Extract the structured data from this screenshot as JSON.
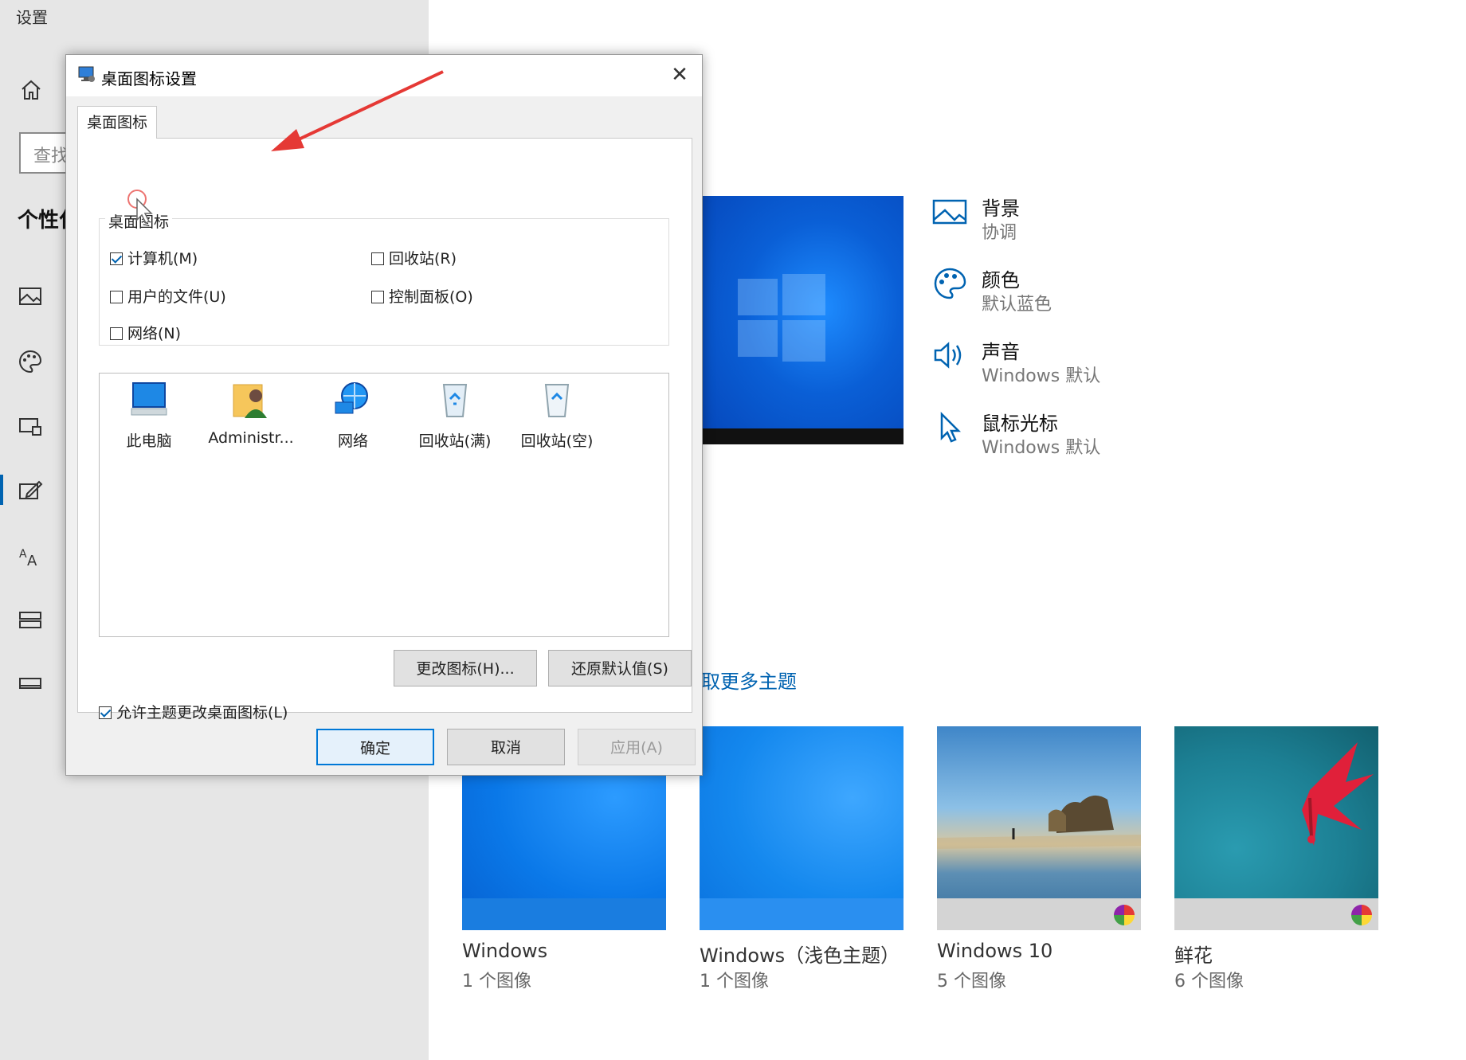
{
  "sidebar": {
    "app_title": "设置",
    "search_placeholder": "查找",
    "section_title": "个性化"
  },
  "dialog": {
    "title": "桌面图标设置",
    "tab": "桌面图标",
    "group_label": "桌面图标",
    "checkboxes": [
      {
        "label": "计算机(M)",
        "checked": true
      },
      {
        "label": "回收站(R)",
        "checked": false
      },
      {
        "label": "用户的文件(U)",
        "checked": false
      },
      {
        "label": "控制面板(O)",
        "checked": false
      },
      {
        "label": "网络(N)",
        "checked": false
      }
    ],
    "icons": [
      "此电脑",
      "Administr...",
      "网络",
      "回收站(满)",
      "回收站(空)"
    ],
    "change_icon_button": "更改图标(H)...",
    "restore_default_button": "还原默认值(S)",
    "allow_theme_label": "允许主题更改桌面图标(L)",
    "allow_theme_checked": true,
    "ok_button": "确定",
    "cancel_button": "取消",
    "apply_button": "应用(A)"
  },
  "properties": [
    {
      "title": "背景",
      "sub": "协调",
      "icon": "picture-icon"
    },
    {
      "title": "颜色",
      "sub": "默认蓝色",
      "icon": "palette-icon"
    },
    {
      "title": "声音",
      "sub": "Windows 默认",
      "icon": "speaker-icon"
    },
    {
      "title": "鼠标光标",
      "sub": "Windows 默认",
      "icon": "cursor-icon"
    }
  ],
  "more_themes_link": "取更多主题",
  "themes": [
    {
      "name": "Windows",
      "count": "1 个图像"
    },
    {
      "name": "Windows（浅色主题）",
      "count": "1 个图像"
    },
    {
      "name": "Windows 10",
      "count": "5 个图像"
    },
    {
      "name": "鲜花",
      "count": "6 个图像"
    }
  ],
  "colors": {
    "accent": "#0063b1",
    "link": "#0063b1"
  }
}
